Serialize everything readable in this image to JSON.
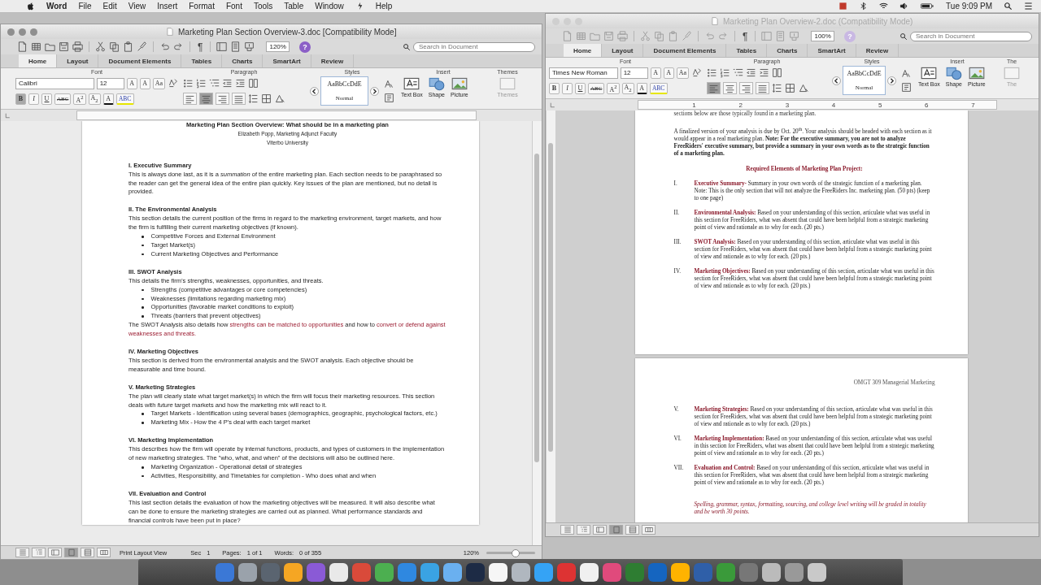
{
  "menu_bar": {
    "app": "Word",
    "items": [
      "File",
      "Edit",
      "View",
      "Insert",
      "Format",
      "Font",
      "Tools",
      "Table",
      "Window",
      "Help"
    ],
    "clock": "Tue 9:09 PM"
  },
  "windows": [
    {
      "title": "Marketing Plan Section Overview-3.doc [Compatibility Mode]",
      "active": true,
      "toolbar": {
        "pilcrow": "¶",
        "zoom": "120%",
        "help": "?",
        "search_placeholder": "Search in Document"
      },
      "tabs": [
        {
          "label": "Home",
          "selected": true
        },
        {
          "label": "Layout",
          "selected": false
        },
        {
          "label": "Document Elements",
          "selected": false
        },
        {
          "label": "Tables",
          "selected": false
        },
        {
          "label": "Charts",
          "selected": false
        },
        {
          "label": "SmartArt",
          "selected": false
        },
        {
          "label": "Review",
          "selected": false
        }
      ],
      "ribbon": {
        "groups": [
          "Font",
          "Paragraph",
          "Styles",
          "Insert",
          "Themes"
        ],
        "font_name": "Calibri",
        "font_size": "12",
        "size_buttons": [
          "A",
          "A",
          "Aa"
        ],
        "format_buttons": [
          {
            "label": "B",
            "selected": true
          },
          {
            "label": "I",
            "selected": false
          },
          {
            "label": "U",
            "selected": false
          },
          {
            "label": "ABC",
            "selected": false
          },
          {
            "label": "A$^{2}$",
            "selected": false
          },
          {
            "label": "A$_{2}$",
            "selected": false
          },
          {
            "label": "A",
            "selected": false
          },
          {
            "label": "ABC",
            "selected": false
          }
        ],
        "align_buttons": [
          {
            "selected": false
          },
          {
            "selected": true
          },
          {
            "selected": false
          },
          {
            "selected": false
          }
        ],
        "style": {
          "sample": "AaBbCcDdE",
          "name": "Normal"
        },
        "insert": [
          "Text Box",
          "Shape",
          "Picture"
        ],
        "themes": "Themes"
      },
      "document": {
        "pages": [
          {
            "blocks": [
              {
                "kind": "title",
                "text": "Marketing Plan Section Overview: What should be in a marketing plan"
              },
              {
                "kind": "byline",
                "text": "Elizabeth Popp, Marketing Adjunct Faculty"
              },
              {
                "kind": "byline",
                "text": "Viterbo University"
              },
              {
                "kind": "heading",
                "text": "I. Executive Summary"
              },
              {
                "kind": "para",
                "text": "This is always done last, as it is a *summation* of the entire marketing plan.  Each section needs to be paraphrased so the reader can get the general idea of the entire plan quickly. Key issues of the plan are mentioned, but no detail is provided."
              },
              {
                "kind": "heading",
                "text": "II. The Environmental Analysis"
              },
              {
                "kind": "para",
                "text": "This section details the current position of the firms in regard to the marketing environment, target markets, and how the firm is fulfilling their current marketing objectives (if known)."
              },
              {
                "kind": "bullets",
                "items": [
                  "Competitive Forces and External Environment",
                  "Target Market(s)",
                  "Current Marketing Objectives and Performance"
                ]
              },
              {
                "kind": "heading",
                "text": "III. SWOT Analysis"
              },
              {
                "kind": "para",
                "text": "This details the firm’s strengths, weaknesses, opportunities, and threats."
              },
              {
                "kind": "bullets",
                "items": [
                  "Strengths (competitive advantages or core competencies)",
                  "Weaknesses (limitations regarding marketing mix)",
                  "Opportunities (favorable market conditions to exploit)",
                  "Threats (barriers that prevent objectives)"
                ]
              },
              {
                "kind": "highlighted",
                "parts": [
                  {
                    "text": "The SWOT Analysis also details how ",
                    "highlight": false
                  },
                  {
                    "text": "strengths can be matched to opportunities",
                    "highlight": true
                  },
                  {
                    "text": " and how to ",
                    "highlight": false
                  },
                  {
                    "text": "convert or defend against weaknesses and threats.",
                    "highlight": true
                  }
                ]
              },
              {
                "kind": "heading",
                "text": "IV. Marketing Objectives"
              },
              {
                "kind": "para",
                "text": "This section is derived from the environmental analysis and the SWOT analysis. Each objective should be measurable and time bound."
              },
              {
                "kind": "heading",
                "text": "V. Marketing Strategies"
              },
              {
                "kind": "para",
                "text": "The plan will clearly state what target market(s) in which the firm will focus their marketing resources. This section deals with *future* target markets and how the marketing mix will react to it."
              },
              {
                "kind": "bullets",
                "items": [
                  "Target Markets - Identification using several bases (demographics, geographic, psychological factors, etc.)",
                  "Marketing Mix - How the 4 P’s deal with each target market"
                ]
              },
              {
                "kind": "heading",
                "text": "VI. Marketing Implementation"
              },
              {
                "kind": "para",
                "text": "This describes how the firm will operate by internal functions, products, and types of customers in the implementation of new marketing strategies. The \"who, what, and when\" of the decisions will also be outlined here."
              },
              {
                "kind": "bullets",
                "items": [
                  "Marketing Organization - Operational detail of strategies",
                  "Activities, Responsibility, and Timetables for completion - Who does what and when"
                ]
              },
              {
                "kind": "heading",
                "text": "VII. Evaluation and Control"
              },
              {
                "kind": "para",
                "text": "This last section details the evaluation of how the marketing objectives will be measured. It will also describe what can be done to ensure the marketing strategies are carried out as planned. What performance standards and financial controls have been put in place?"
              }
            ]
          }
        ]
      },
      "status": {
        "view_buttons": [
          {
            "selected": false
          },
          {
            "selected": false
          },
          {
            "selected": false
          },
          {
            "selected": true
          },
          {
            "selected": false
          },
          {
            "selected": false
          }
        ],
        "view": "Print Layout View",
        "fields": [
          {
            "label": "Sec",
            "value": "1"
          },
          {
            "label": "Pages:",
            "value": "1 of 1"
          },
          {
            "label": "Words:",
            "value": "0 of 355"
          }
        ],
        "zoom": "120%",
        "zoom_slider": {
          "level": 0.6
        }
      }
    },
    {
      "title": "Marketing Plan Overview-2.doc (Compatibility Mode)",
      "active": false,
      "toolbar": {
        "pilcrow": "¶",
        "zoom": "100%",
        "help": "?",
        "search_placeholder": "Search in Document"
      },
      "tabs": [
        {
          "label": "Home",
          "selected": true
        },
        {
          "label": "Layout",
          "selected": false
        },
        {
          "label": "Document Elements",
          "selected": false
        },
        {
          "label": "Tables",
          "selected": false
        },
        {
          "label": "Charts",
          "selected": false
        },
        {
          "label": "SmartArt",
          "selected": false
        },
        {
          "label": "Review",
          "selected": false
        }
      ],
      "ribbon": {
        "groups": [
          "Font",
          "Paragraph",
          "Styles",
          "Insert",
          "The"
        ],
        "font_name": "Times New Roman",
        "font_size": "12",
        "size_buttons": [
          "A",
          "A",
          "Aa"
        ],
        "format_buttons": [
          {
            "label": "B",
            "selected": false
          },
          {
            "label": "I",
            "selected": false
          },
          {
            "label": "U",
            "selected": false
          },
          {
            "label": "ABC",
            "selected": false
          },
          {
            "label": "A$^{2}$",
            "selected": false
          },
          {
            "label": "A$_{2}$",
            "selected": false
          },
          {
            "label": "A",
            "selected": false
          },
          {
            "label": "ABC",
            "selected": false
          }
        ],
        "align_buttons": [
          {
            "selected": true
          },
          {
            "selected": false
          },
          {
            "selected": false
          },
          {
            "selected": false
          }
        ],
        "style": {
          "sample": "AaBbCcDdE",
          "name": "Normal"
        },
        "insert": [
          "Text Box",
          "Shape",
          "Picture"
        ],
        "themes": "The"
      },
      "ruler": [
        "1",
        "2",
        "3",
        "4",
        "5",
        "6",
        "7"
      ],
      "document": {
        "pages": [
          {
            "blocks": [
              {
                "kind": "cut_line",
                "text": "sections below are those typically found in a marketing plan."
              },
              {
                "kind": "para",
                "text": "A finalized version of your analysis is due by Oct. 20$^{th}$. Your analysis should be headed with each section as it would appear in a real marketing plan. **Note: For the executive summary, you are not to analyze FreeRiders' executive summary, but provide a summary in your own words as to the strategic function of a marketing plan.**"
              },
              {
                "kind": "center_heading",
                "text": "Required Elements of Marketing Plan Project:"
              },
              {
                "kind": "numbered",
                "numeral": "I.",
                "text": "**Executive Summary-** Summary in your own words of the strategic function of a marketing plan. Note: This is the only section that will not analyze the FreeRiders Inc. marketing plan. (50 pts) (keep to one page)"
              },
              {
                "kind": "numbered",
                "numeral": "II.",
                "text": "**Environmental Analysis:** Based on your understanding of this section, articulate what was useful in this section for FreeRiders, what was absent that could have been helpful from a strategic marketing point of view and rationale as to why for each. (20 pts.)"
              },
              {
                "kind": "numbered",
                "numeral": "III.",
                "text": "**SWOT Analysis:** Based on your understanding of this section, articulate what was useful in this section for FreeRiders, what was absent that could have been helpful from a strategic marketing point of view and rationale as to why for each. (20 pts.)"
              },
              {
                "kind": "numbered",
                "numeral": "IV.",
                "text": "**Marketing Objectives:** Based on your understanding of this section, articulate what was useful in this section for FreeRiders, what was absent that could have been helpful from a strategic marketing point of view and rationale as to why for each. (20 pts.)"
              }
            ]
          },
          {
            "blocks": [
              {
                "kind": "header_right",
                "text": "OMGT 309 Managerial Marketing"
              },
              {
                "kind": "numbered",
                "numeral": "V.",
                "text": "**Marketing Strategies:** Based on your understanding of this section, articulate what was useful in this section for FreeRiders, what was absent that could have been helpful from a strategic marketing point of view and rationale as to why for each. (20 pts.)"
              },
              {
                "kind": "numbered",
                "numeral": "VI.",
                "text": "**Marketing Implementation:** Based on your understanding of this section, articulate what was useful in this section for FreeRiders, what was absent that could have been helpful from a strategic marketing point of view and rationale as to why for each. (20 pts.)"
              },
              {
                "kind": "numbered",
                "numeral": "VII.",
                "text": "**Evaluation and Control:** Based on your understanding of this section, articulate what was useful in this section for FreeRiders, what was absent that could have been helpful from a strategic marketing point of view and rationale as to why for each. (20 pts.)"
              },
              {
                "kind": "note",
                "text": "Spelling, grammar, syntax, formatting, sourcing, and college level writing will be graded in totality and be worth 30 points."
              }
            ]
          }
        ]
      },
      "status": {
        "view_buttons": [
          {
            "selected": false
          },
          {
            "selected": false
          },
          {
            "selected": false
          },
          {
            "selected": true
          },
          {
            "selected": false
          },
          {
            "selected": false
          }
        ]
      }
    }
  ]
}
